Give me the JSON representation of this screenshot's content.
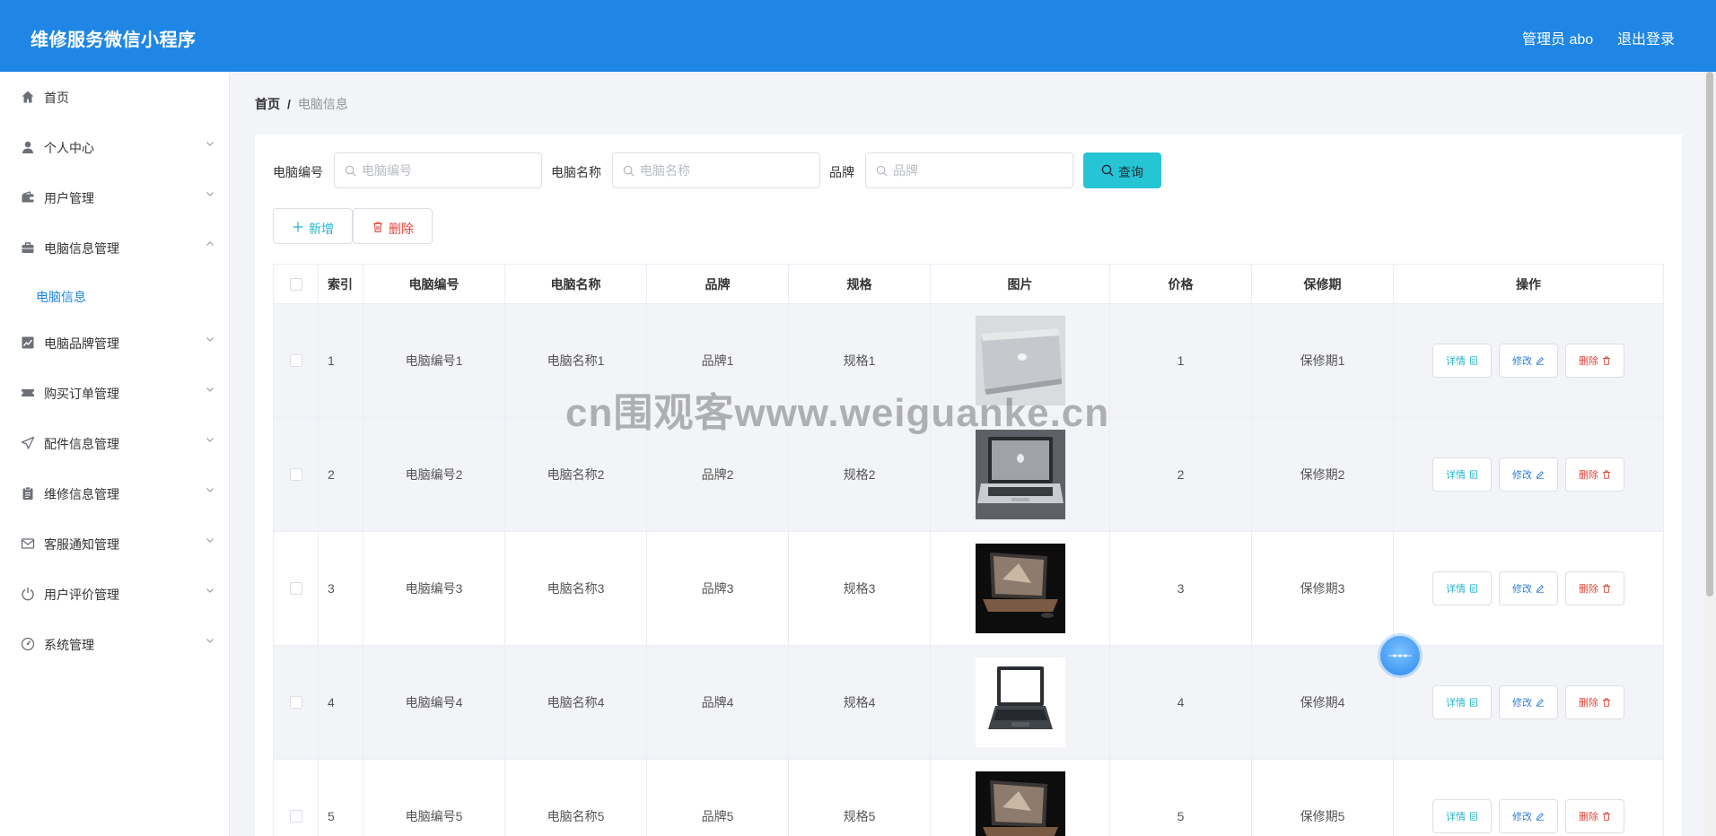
{
  "header": {
    "app_title": "维修服务微信小程序",
    "admin_label": "管理员 abo",
    "logout_label": "退出登录"
  },
  "sidebar": {
    "items": [
      {
        "label": "首页",
        "icon": "home-icon"
      },
      {
        "label": "个人中心",
        "icon": "user-icon"
      },
      {
        "label": "用户管理",
        "icon": "wallet-icon"
      },
      {
        "label": "电脑信息管理",
        "icon": "briefcase-icon"
      },
      {
        "label": "电脑品牌管理",
        "icon": "chart-icon"
      },
      {
        "label": "购买订单管理",
        "icon": "ticket-icon"
      },
      {
        "label": "配件信息管理",
        "icon": "send-icon"
      },
      {
        "label": "维修信息管理",
        "icon": "clipboard-icon"
      },
      {
        "label": "客服通知管理",
        "icon": "mail-icon"
      },
      {
        "label": "用户评价管理",
        "icon": "power-icon"
      },
      {
        "label": "系统管理",
        "icon": "gauge-icon"
      }
    ],
    "sub_item": "电脑信息"
  },
  "breadcrumb": {
    "home": "首页",
    "separator": "/",
    "current": "电脑信息"
  },
  "search": {
    "code_label": "电脑编号",
    "code_placeholder": "电脑编号",
    "name_label": "电脑名称",
    "name_placeholder": "电脑名称",
    "brand_label": "品牌",
    "brand_placeholder": "品牌",
    "query_label": "查询"
  },
  "toolbar": {
    "add_label": "新增",
    "delete_label": "删除"
  },
  "table": {
    "headers": [
      "索引",
      "电脑编号",
      "电脑名称",
      "品牌",
      "规格",
      "图片",
      "价格",
      "保修期",
      "操作"
    ],
    "rows": [
      {
        "index": "1",
        "code": "电脑编号1",
        "name": "电脑名称1",
        "brand": "品牌1",
        "spec": "规格1",
        "price": "1",
        "warranty": "保修期1"
      },
      {
        "index": "2",
        "code": "电脑编号2",
        "name": "电脑名称2",
        "brand": "品牌2",
        "spec": "规格2",
        "price": "2",
        "warranty": "保修期2"
      },
      {
        "index": "3",
        "code": "电脑编号3",
        "name": "电脑名称3",
        "brand": "品牌3",
        "spec": "规格3",
        "price": "3",
        "warranty": "保修期3"
      },
      {
        "index": "4",
        "code": "电脑编号4",
        "name": "电脑名称4",
        "brand": "品牌4",
        "spec": "规格4",
        "price": "4",
        "warranty": "保修期4"
      },
      {
        "index": "5",
        "code": "电脑编号5",
        "name": "电脑名称5",
        "brand": "品牌5",
        "spec": "规格5",
        "price": "5",
        "warranty": "保修期5"
      }
    ],
    "ops": {
      "detail": "详情",
      "edit": "修改",
      "delete": "删除"
    }
  },
  "watermark": "cn围观客www.weiguanke.cn",
  "colors": {
    "header_bg": "#1f86e5",
    "accent_cyan": "#25c5d6",
    "danger": "#e2453c"
  }
}
